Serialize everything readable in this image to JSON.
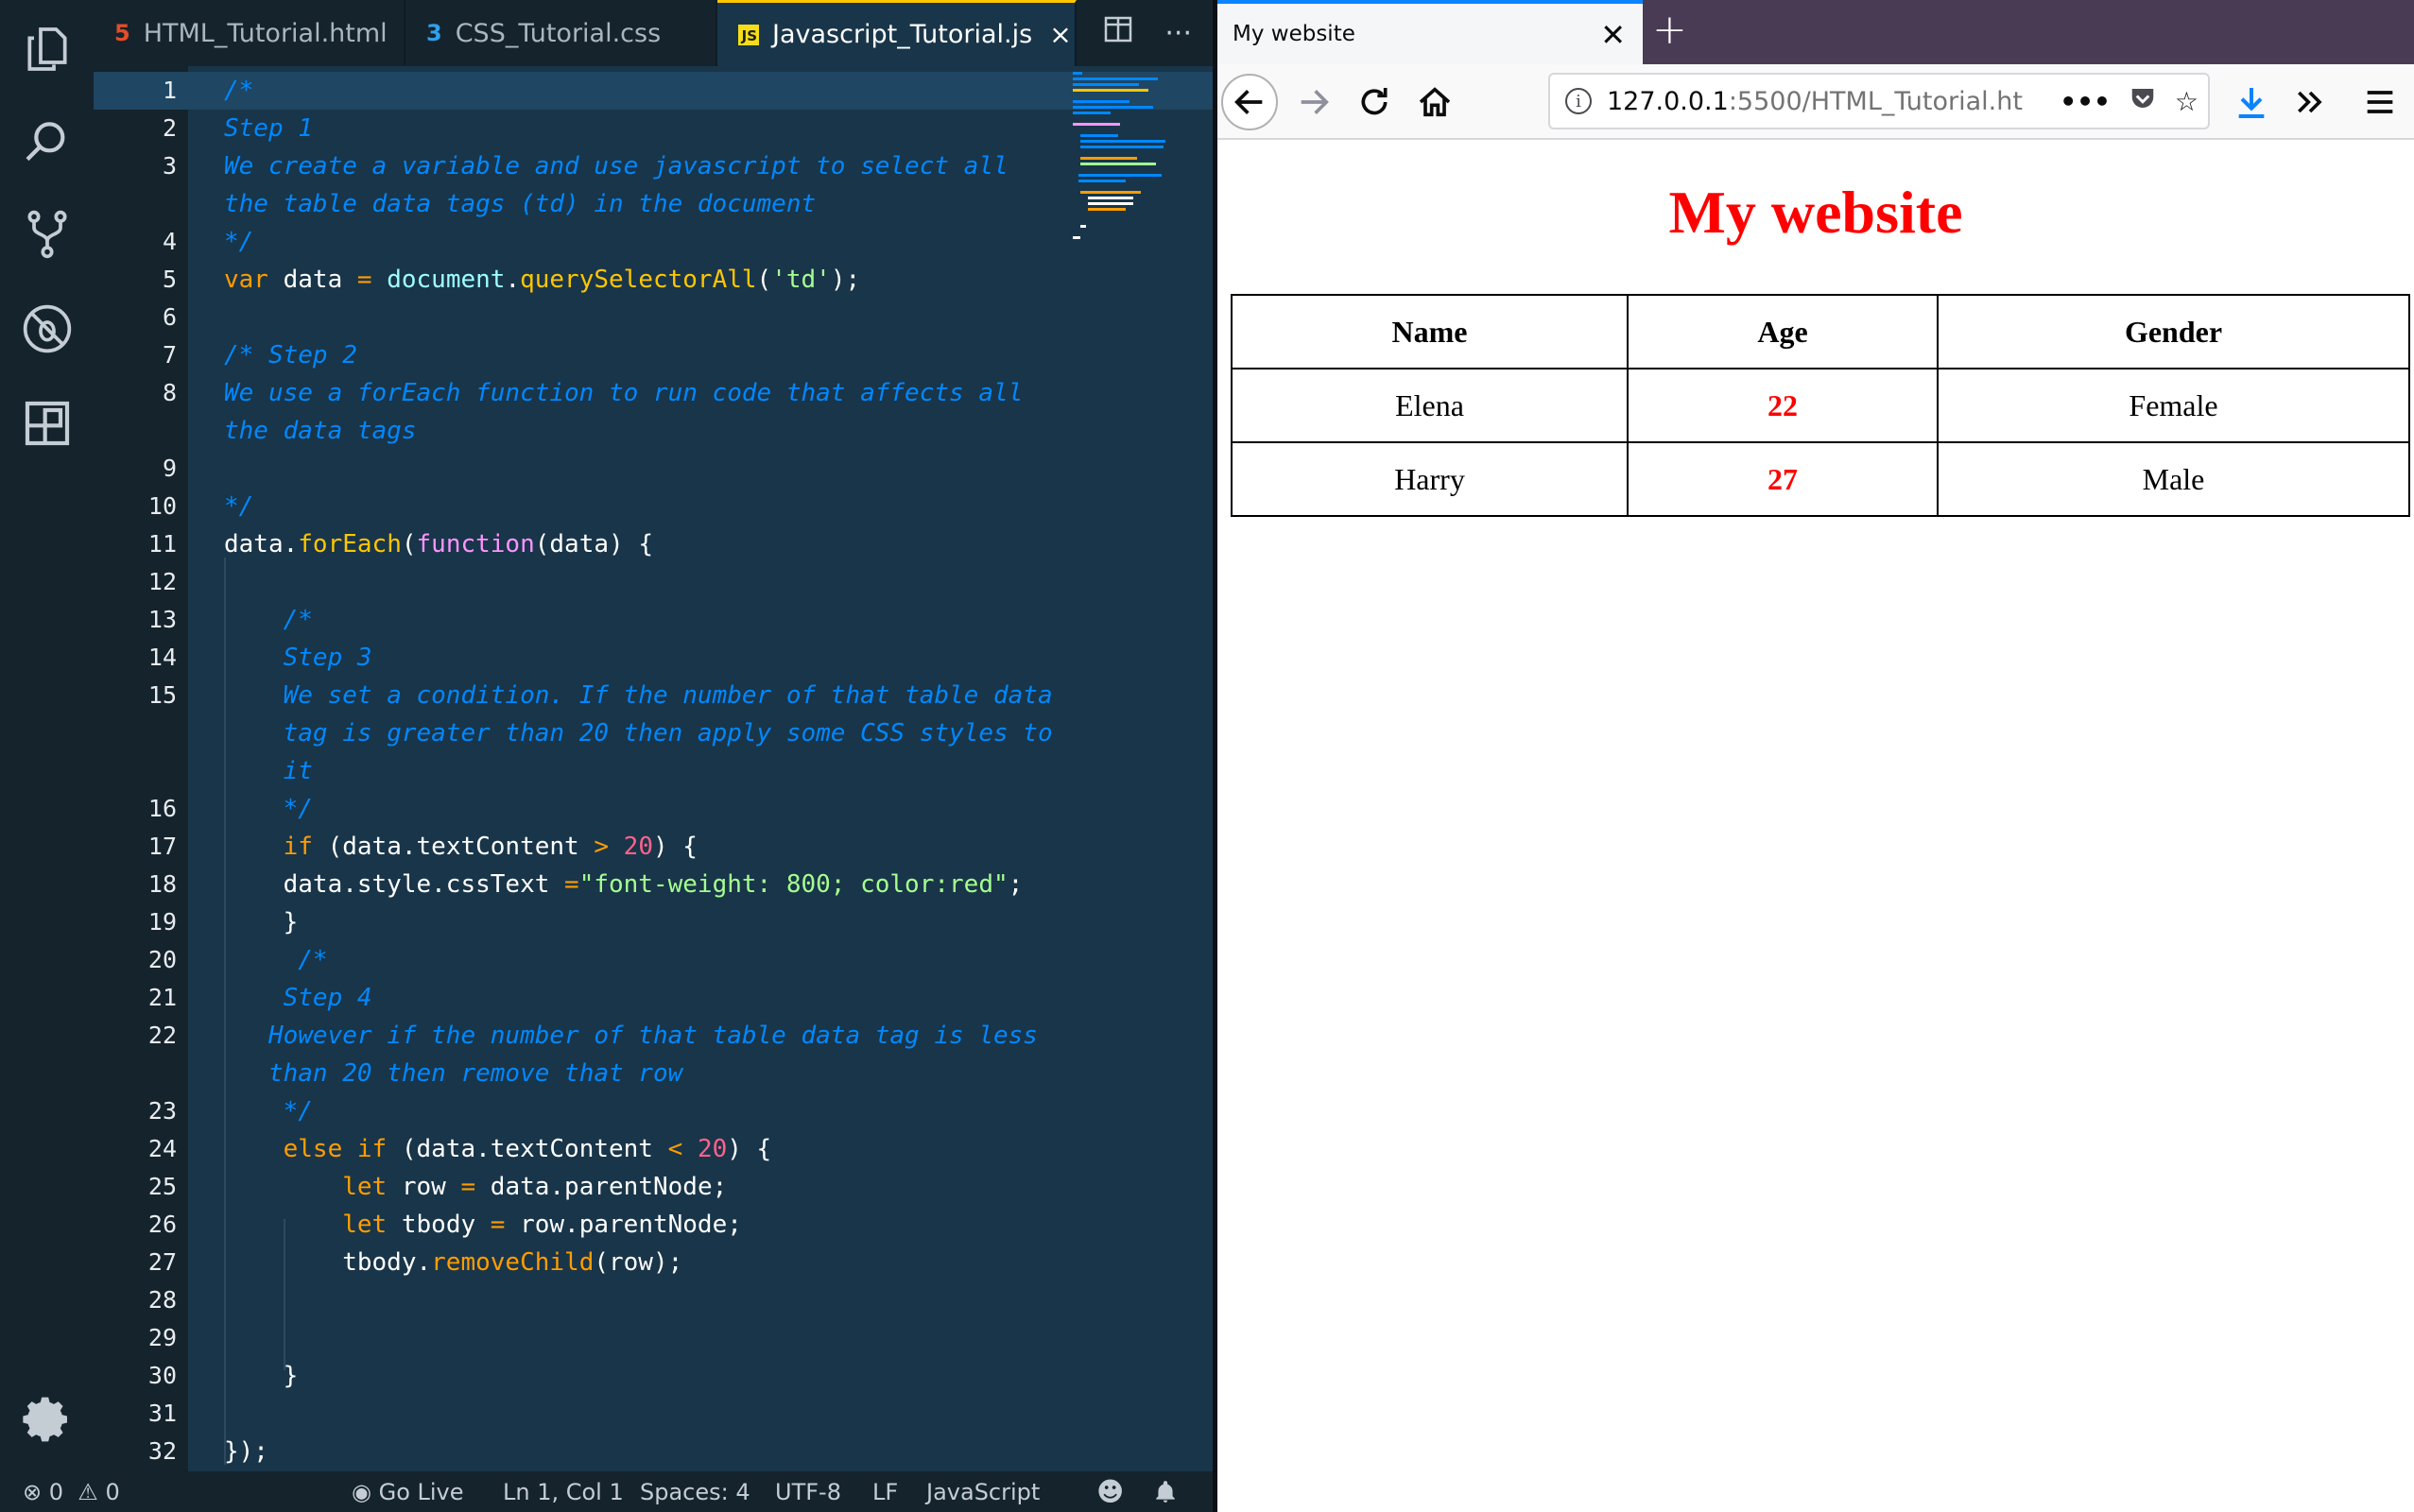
{
  "editor": {
    "tabs": [
      {
        "label": "HTML_Tutorial.html",
        "type": "html"
      },
      {
        "label": "CSS_Tutorial.css",
        "type": "css"
      },
      {
        "label": "Javascript_Tutorial.js",
        "type": "js",
        "active": true
      }
    ],
    "lines": [
      {
        "num": "1",
        "html": "<span class='c'>/*</span>",
        "cursor": true
      },
      {
        "num": "2",
        "html": "<span class='c'>Step 1</span>"
      },
      {
        "num": "3",
        "html": "<span class='c'>We create a variable and use javascript to select all</span>"
      },
      {
        "num": "",
        "html": "<span class='c'>the table data tags (td) in the document</span>"
      },
      {
        "num": "4",
        "html": "<span class='c'>*/</span>"
      },
      {
        "num": "5",
        "html": "<span class='k'>var</span> data <span class='o'>=</span> <span class='m'>document</span>.<span class='f'>querySelectorAll</span>(<span class='s'>'td'</span>);"
      },
      {
        "num": "6",
        "html": ""
      },
      {
        "num": "7",
        "html": "<span class='c'>/* Step 2</span>"
      },
      {
        "num": "8",
        "html": "<span class='c'>We use a forEach function to run code that affects all</span>"
      },
      {
        "num": "",
        "html": "<span class='c'>the data tags</span>"
      },
      {
        "num": "9",
        "html": ""
      },
      {
        "num": "10",
        "html": "<span class='c'>*/</span>"
      },
      {
        "num": "11",
        "html": "data.<span class='f'>forEach</span>(<span class='fn'>function</span>(data) {"
      },
      {
        "num": "12",
        "html": ""
      },
      {
        "num": "13",
        "html": "    <span class='c'>/*</span>"
      },
      {
        "num": "14",
        "html": "    <span class='c'>Step 3</span>"
      },
      {
        "num": "15",
        "html": "    <span class='c'>We set a condition. If the number of that table data</span>"
      },
      {
        "num": "",
        "html": "    <span class='c'>tag is greater than 20 then apply some CSS styles to</span>"
      },
      {
        "num": "",
        "html": "    <span class='c'>it</span>"
      },
      {
        "num": "16",
        "html": "    <span class='c'>*/</span>"
      },
      {
        "num": "17",
        "html": "    <span class='k'>if</span> (data.textContent <span class='o'>&gt;</span> <span class='n'>20</span>) {"
      },
      {
        "num": "18",
        "html": "    data.style.cssText <span class='o'>=</span><span class='s'>\"font-weight: 800; color:red\"</span>;"
      },
      {
        "num": "19",
        "html": "    }"
      },
      {
        "num": "20",
        "html": "     <span class='c'>/*</span>"
      },
      {
        "num": "21",
        "html": "    <span class='c'>Step 4</span>"
      },
      {
        "num": "22",
        "html": "   <span class='c'>However if the number of that table data tag is less</span>"
      },
      {
        "num": "",
        "html": "   <span class='c'>than 20 then remove that row</span>"
      },
      {
        "num": "23",
        "html": "    <span class='c'>*/</span>"
      },
      {
        "num": "24",
        "html": "    <span class='k'>else if</span> (data.textContent <span class='o'>&lt;</span> <span class='n'>20</span>) {"
      },
      {
        "num": "25",
        "html": "        <span class='k'>let</span> row <span class='o'>=</span> data.parentNode;"
      },
      {
        "num": "26",
        "html": "        <span class='k'>let</span> tbody <span class='o'>=</span> row.parentNode;"
      },
      {
        "num": "27",
        "html": "        tbody.<span class='k'>removeChild</span>(row);"
      },
      {
        "num": "28",
        "html": ""
      },
      {
        "num": "29",
        "html": ""
      },
      {
        "num": "30",
        "html": "    }"
      },
      {
        "num": "31",
        "html": ""
      },
      {
        "num": "32",
        "html": "});"
      }
    ],
    "status": {
      "errors": "0",
      "warnings": "0",
      "go_live": "Go Live",
      "position": "Ln 1, Col 1",
      "spaces": "Spaces: 4",
      "encoding": "UTF-8",
      "eol": "LF",
      "language": "JavaScript"
    }
  },
  "browser": {
    "tab_title": "My website",
    "url_host": "127.0.0.1",
    "url_rest": ":5500/HTML_Tutorial.ht",
    "page": {
      "heading": "My website",
      "headers": [
        "Name",
        "Age",
        "Gender"
      ],
      "rows": [
        [
          "Elena",
          "22",
          "Female"
        ],
        [
          "Harry",
          "27",
          "Male"
        ]
      ]
    }
  },
  "colors": {
    "editor_bg": "#193549",
    "sidebar_bg": "#15232d",
    "heading_red": "#ff0000",
    "accent_yellow": "#ffc600",
    "firefox_blue": "#0a84ff"
  }
}
